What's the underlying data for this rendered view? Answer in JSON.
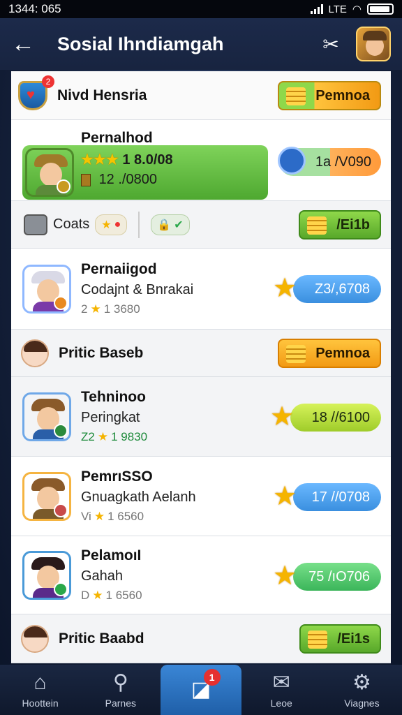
{
  "status": {
    "time": "1344: 065",
    "network": "LTE"
  },
  "appbar": {
    "title": "Sosial Ihndiamgah",
    "back_icon": "arrow-left-icon",
    "tool_icon": "tools-icon",
    "profile_icon": "profile-avatar-icon"
  },
  "header_row": {
    "name": "Nivd Hensria",
    "badge": "2",
    "button": "Pemnoa"
  },
  "featured": {
    "name": "Pernalhod",
    "stars": "★★★",
    "score": "1 8.0/08",
    "sub": "12 ./0800",
    "pill": "1a  /V090"
  },
  "coats": {
    "label": "Coats",
    "button": "/Ei1b"
  },
  "items": [
    {
      "name": "Pernaiigod",
      "sub": "Codajnt & Bnrakai",
      "meta_prefix": "2",
      "meta_value": "1 3680",
      "pill": "Z3/,6708",
      "pill_color": "blue"
    },
    {
      "name": "Pritic Baseb",
      "button": "Pemnoa"
    },
    {
      "name": "Tehninoo",
      "sub": "Peringkat",
      "meta_prefix": "Z2",
      "meta_value": "1 9830",
      "pill": "18 //6100",
      "pill_color": "lime"
    },
    {
      "name": "PemrıSSO",
      "sub": "Gnuagkath Aelanh",
      "meta_prefix": "Vi",
      "meta_value": "1 6560",
      "pill": "17 //0708",
      "pill_color": "blue"
    },
    {
      "name": "PelamoıI",
      "sub": "Gahah",
      "meta_prefix": "D",
      "meta_value": "1 6560",
      "pill": "75 /ıO706",
      "pill_color": "green"
    },
    {
      "name": "Pritic Baabd",
      "button": "/Ei1s"
    }
  ],
  "tabs": [
    {
      "label": "Hoottein",
      "icon": "home-icon"
    },
    {
      "label": "Parnes",
      "icon": "search-icon"
    },
    {
      "label": "",
      "icon": "chart-icon",
      "badge": "1"
    },
    {
      "label": "Leoe",
      "icon": "inbox-icon"
    },
    {
      "label": "Viagnes",
      "icon": "settings-icon"
    }
  ],
  "colors": {
    "accent_orange": "#f29a14",
    "accent_green": "#58a82a",
    "accent_blue": "#3a8fdf",
    "tab_active": "#1f5fa8"
  }
}
